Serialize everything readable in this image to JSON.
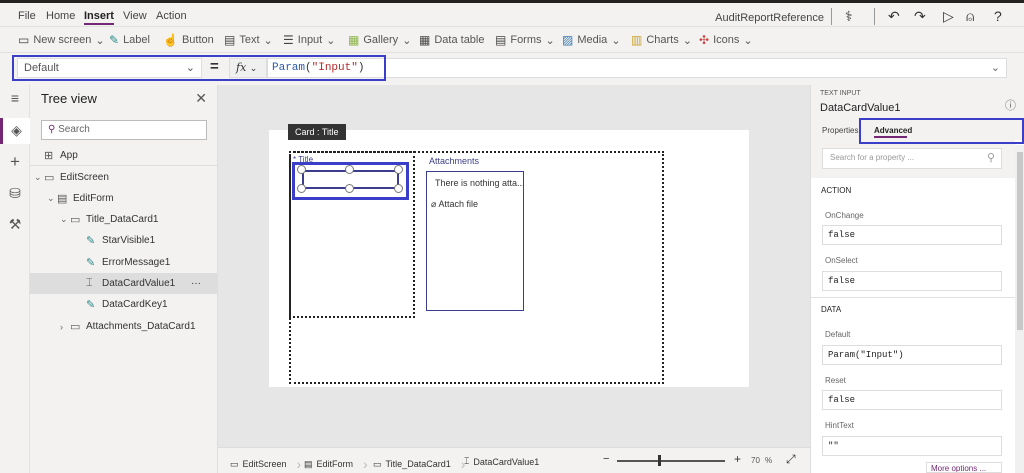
{
  "menu": {
    "items": [
      "File",
      "Home",
      "Insert",
      "View",
      "Action"
    ],
    "active": "Insert"
  },
  "app_title": "AuditReportReference",
  "toolbar": {
    "new_screen": "New screen",
    "label": "Label",
    "button": "Button",
    "text": "Text",
    "input": "Input",
    "gallery": "Gallery",
    "data_table": "Data table",
    "forms": "Forms",
    "media": "Media",
    "charts": "Charts",
    "icons": "Icons"
  },
  "formula": {
    "property": "Default",
    "eq": "=",
    "fx": "fx",
    "fn": "Param",
    "open": "(",
    "arg": "\"Input\"",
    "close": ")"
  },
  "tree": {
    "title": "Tree view",
    "search_placeholder": "Search",
    "items": [
      {
        "label": "App"
      },
      {
        "label": "EditScreen"
      },
      {
        "label": "EditForm"
      },
      {
        "label": "Title_DataCard1"
      },
      {
        "label": "StarVisible1"
      },
      {
        "label": "ErrorMessage1"
      },
      {
        "label": "DataCardValue1",
        "more": "···"
      },
      {
        "label": "DataCardKey1"
      },
      {
        "label": "Attachments_DataCard1"
      }
    ]
  },
  "canvas": {
    "tooltip": "Card : Title",
    "title_label": "Title",
    "attachments_label": "Attachments",
    "attachments_message": "There is nothing atta...",
    "attach_file": "Attach file"
  },
  "status": {
    "crumbs": [
      "EditScreen",
      "EditForm",
      "Title_DataCard1",
      "DataCardValue1"
    ],
    "zoom_minus": "−",
    "zoom_plus": "+",
    "zoom": "70",
    "zoom_unit": "%",
    "zoom_fraction": 0.4
  },
  "right": {
    "type": "TEXT INPUT",
    "name": "DataCardValue1",
    "tabs": [
      "Properties",
      "Advanced"
    ],
    "search_placeholder": "Search for a property ...",
    "sections": [
      {
        "title": "ACTION",
        "props": [
          {
            "name": "OnChange",
            "value": "false"
          },
          {
            "name": "OnSelect",
            "value": "false"
          }
        ]
      },
      {
        "title": "DATA",
        "props": [
          {
            "name": "Default",
            "value": "Param(\"Input\")"
          },
          {
            "name": "Reset",
            "value": "false"
          },
          {
            "name": "HintText",
            "value": "\"\""
          }
        ]
      }
    ],
    "more_options": "More options ..."
  },
  "colors": {
    "accent": "#742774",
    "highlight": "#3b3ec8"
  }
}
